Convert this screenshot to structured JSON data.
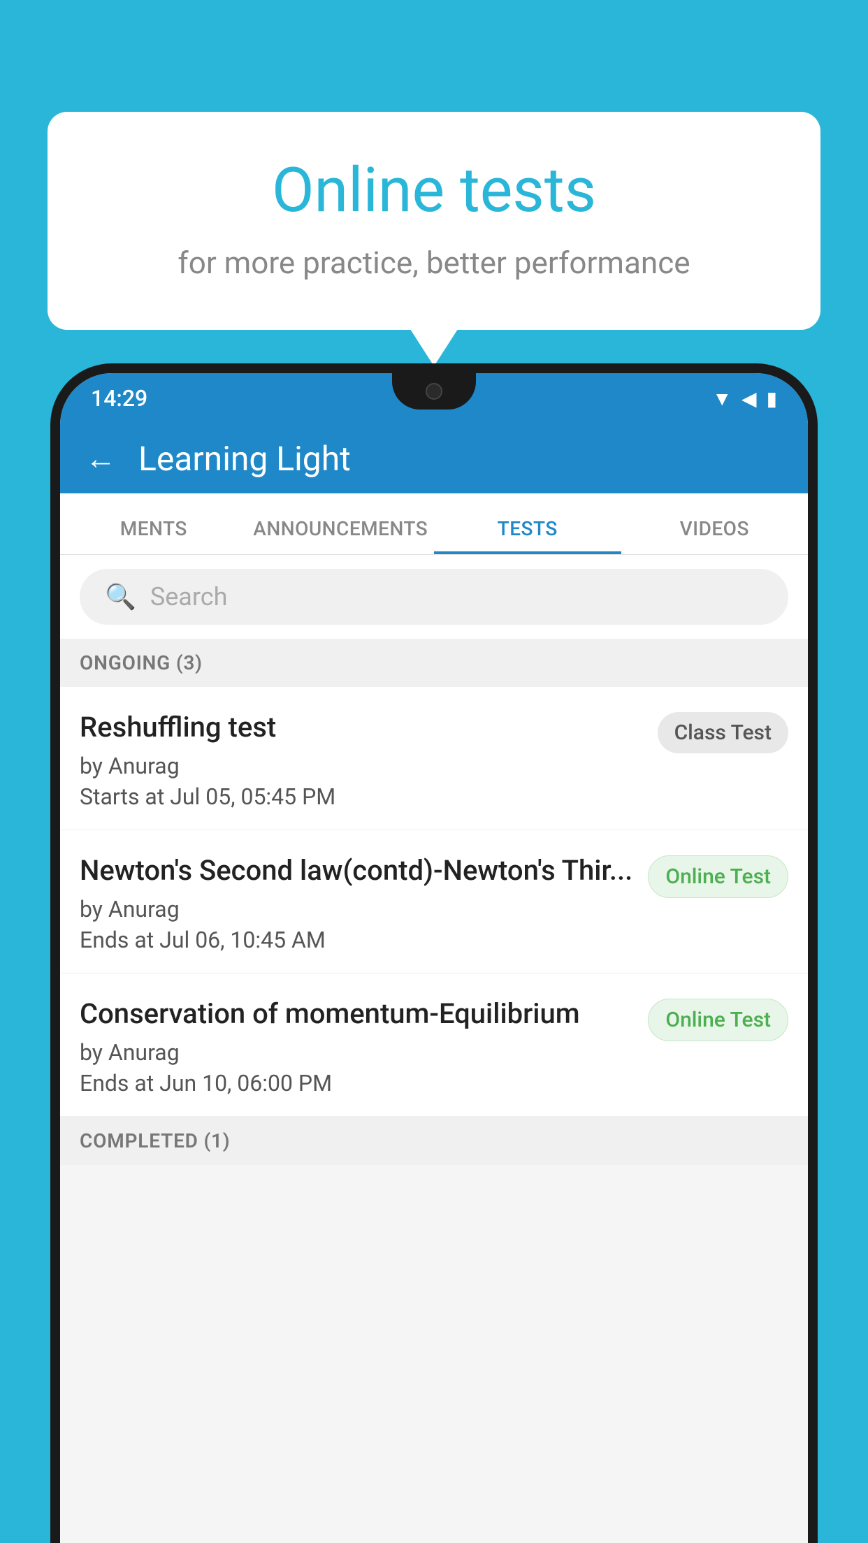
{
  "background_color": "#29b6d8",
  "bubble": {
    "title": "Online tests",
    "subtitle": "for more practice, better performance"
  },
  "phone": {
    "status_bar": {
      "time": "14:29",
      "icons": [
        "▼",
        "◀",
        "▮"
      ]
    },
    "app_bar": {
      "back_label": "←",
      "title": "Learning Light"
    },
    "tabs": [
      {
        "label": "MENTS",
        "active": false
      },
      {
        "label": "ANNOUNCEMENTS",
        "active": false
      },
      {
        "label": "TESTS",
        "active": true
      },
      {
        "label": "VIDEOS",
        "active": false
      }
    ],
    "search": {
      "placeholder": "Search"
    },
    "ongoing_section": {
      "label": "ONGOING (3)"
    },
    "tests": [
      {
        "name": "Reshuffling test",
        "author": "by Anurag",
        "time_label": "Starts at  Jul 05, 05:45 PM",
        "badge": "Class Test",
        "badge_type": "class"
      },
      {
        "name": "Newton's Second law(contd)-Newton's Thir...",
        "author": "by Anurag",
        "time_label": "Ends at  Jul 06, 10:45 AM",
        "badge": "Online Test",
        "badge_type": "online"
      },
      {
        "name": "Conservation of momentum-Equilibrium",
        "author": "by Anurag",
        "time_label": "Ends at  Jun 10, 06:00 PM",
        "badge": "Online Test",
        "badge_type": "online"
      }
    ],
    "completed_section": {
      "label": "COMPLETED (1)"
    }
  }
}
